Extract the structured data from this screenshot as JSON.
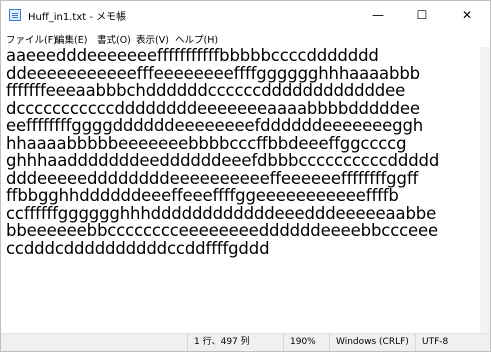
{
  "window": {
    "title": "Huff_in1.txt - メモ帳",
    "min_glyph": "—",
    "max_glyph": "☐",
    "close_glyph": "✕"
  },
  "menu": {
    "file": "ファイル(F)",
    "edit": "編集(E)",
    "format": "書式(O)",
    "view": "表示(V)",
    "help": "ヘルプ(H)"
  },
  "editor": {
    "lines": [
      "aaeeedddeeeeeeefffffffffffbbbbbccccddddddd",
      "ddeeeeeeeeeeefffeeeeeeeeffffgggggghhhaaaabbb",
      "fffffffeeeaabbbchddddddccccccddddddddddddee",
      "dcccccccccccddddddddeeeeeeeaaaabbbbdddddee",
      "eeffffffffggggddddddeeeeeeeefddddddeeeeeeeggh",
      "hhaaaabbbbbeeeeeeebbbbcccffbbdeeeffggccccg",
      "ghhhaadddddddeeddddddeeefdbbbccccccccccddddd",
      "dddeeeeeddddddddeeeeeeeeeeffeeeeeeffffffffggff",
      "ffbbgghhddddddeeeffeeeffffggeeeeeeeeeeeffffb",
      "ccffffffgggggghhhddddddddddddeeedddeeeeeaabbe",
      "bbeeeeeebbcccccccceeeeeeeeddddddeeeebbccceee",
      "ccdddcddddddddddccddffffgddd"
    ]
  },
  "status": {
    "position": "1 行、497 列",
    "zoom": "190%",
    "eol": "Windows (CRLF)",
    "encoding": "UTF-8"
  }
}
